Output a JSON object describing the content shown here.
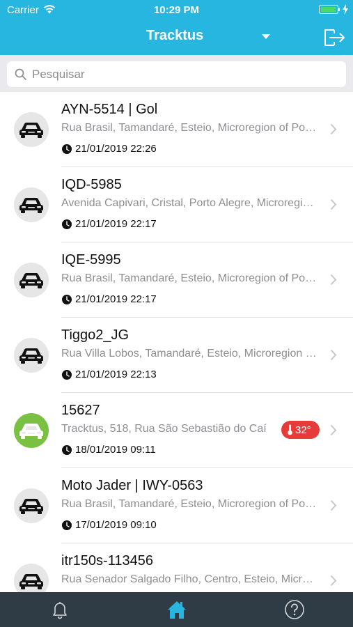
{
  "status_bar": {
    "carrier": "Carrier",
    "time": "10:29 PM"
  },
  "nav": {
    "title": "Tracktus",
    "dropdown_icon": "caret-down-icon",
    "logout_icon": "logout-icon"
  },
  "search": {
    "placeholder": "Pesquisar",
    "value": ""
  },
  "vehicles": [
    {
      "name": "AYN-5514 | Gol",
      "address": "Rua Brasil, Tamandaré, Esteio, Microregion of Porto Alegre",
      "time": "21/01/2019 22:26",
      "active": false
    },
    {
      "name": "IQD-5985",
      "address": "Avenida Capivari, Cristal, Porto Alegre, Microregion of Porto Alegre",
      "time": "21/01/2019 22:17",
      "active": false
    },
    {
      "name": "IQE-5995",
      "address": "Rua Brasil, Tamandaré, Esteio, Microregion of Porto Alegre",
      "time": "21/01/2019 22:17",
      "active": false
    },
    {
      "name": "Tiggo2_JG",
      "address": "Rua Villa Lobos, Tamandaré, Esteio, Microregion of Porto Alegre",
      "time": "21/01/2019 22:13",
      "active": false
    },
    {
      "name": "15627",
      "address": "Tracktus, 518, Rua São Sebastião do Caí",
      "time": "18/01/2019 09:11",
      "active": true,
      "temperature": "32°"
    },
    {
      "name": "Moto Jader | IWY-0563",
      "address": "Rua Brasil, Tamandaré, Esteio, Microregion of Porto Alegre",
      "time": "17/01/2019 09:10",
      "active": false
    },
    {
      "name": "itr150s-113456",
      "address": "Rua Senador Salgado Filho, Centro, Esteio, Microregion of Porto Alegre",
      "time": "",
      "active": false
    }
  ],
  "tabbar": {
    "items": [
      {
        "icon": "bell-icon",
        "active": false
      },
      {
        "icon": "home-icon",
        "active": true
      },
      {
        "icon": "help-icon",
        "active": false
      }
    ]
  },
  "colors": {
    "header": "#27b6df",
    "active_vehicle": "#7ac143",
    "temp_badge": "#e63b3b",
    "tabbar": "#2f3b45",
    "tab_active": "#27b6df"
  }
}
